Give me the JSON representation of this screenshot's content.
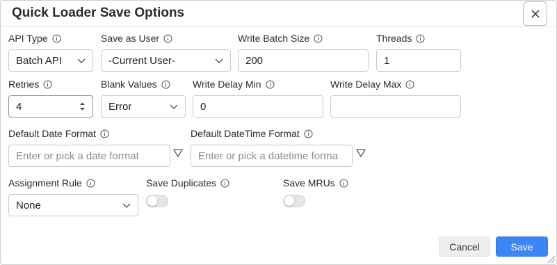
{
  "dialog": {
    "title": "Quick Loader Save Options",
    "close_label": "×"
  },
  "fields": {
    "api_type": {
      "label": "API Type",
      "value": "Batch API"
    },
    "save_as_user": {
      "label": "Save as User",
      "value": "-Current User-"
    },
    "write_batch_size": {
      "label": "Write Batch Size",
      "value": "200"
    },
    "threads": {
      "label": "Threads",
      "value": "1"
    },
    "retries": {
      "label": "Retries",
      "value": "4"
    },
    "blank_values": {
      "label": "Blank Values",
      "value": "Error"
    },
    "write_delay_min": {
      "label": "Write Delay Min",
      "value": "0"
    },
    "write_delay_max": {
      "label": "Write Delay Max",
      "value": ""
    },
    "default_date_format": {
      "label": "Default Date Format",
      "value": "",
      "placeholder": "Enter or pick a date format"
    },
    "default_datetime_format": {
      "label": "Default DateTime Format",
      "value": "",
      "placeholder": "Enter or pick a datetime forma"
    },
    "assignment_rule": {
      "label": "Assignment Rule",
      "value": "None"
    },
    "save_duplicates": {
      "label": "Save Duplicates",
      "enabled": false
    },
    "save_mrus": {
      "label": "Save MRUs",
      "enabled": false
    }
  },
  "footer": {
    "cancel_label": "Cancel",
    "save_label": "Save"
  },
  "colors": {
    "primary": "#3b86f5",
    "toggle_off": "#e6e6e6",
    "border": "#c9c9c9"
  },
  "icons": [
    "close-icon",
    "info-icon",
    "chevron-down-icon",
    "spinner-icon",
    "filter-icon",
    "resize-grip-icon"
  ]
}
